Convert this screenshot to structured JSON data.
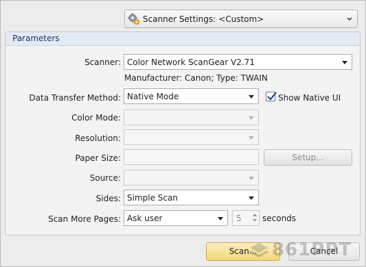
{
  "settings": {
    "label": "Scanner Settings:",
    "value": "<Custom>"
  },
  "group": {
    "title": "Parameters"
  },
  "fields": {
    "scanner": {
      "label": "Scanner:",
      "value": "Color Network ScanGear V2.71"
    },
    "manufacturer_info": "Manufacturer: Canon; Type: TWAIN",
    "data_transfer": {
      "label": "Data Transfer Method:",
      "value": "Native Mode"
    },
    "show_native_ui": {
      "label": "Show Native UI",
      "checked": true
    },
    "color_mode": {
      "label": "Color Mode:",
      "value": ""
    },
    "resolution": {
      "label": "Resolution:",
      "value": ""
    },
    "paper_size": {
      "label": "Paper Size:",
      "value": "",
      "setup_label": "Setup..."
    },
    "source": {
      "label": "Source:",
      "value": ""
    },
    "sides": {
      "label": "Sides:",
      "value": "Simple Scan"
    },
    "scan_more": {
      "label": "Scan More Pages:",
      "value": "Ask user",
      "seconds_value": "5",
      "seconds_label": "seconds"
    }
  },
  "buttons": {
    "scan": "Scan...",
    "cancel": "Cancel"
  },
  "watermark": "861PPT"
}
